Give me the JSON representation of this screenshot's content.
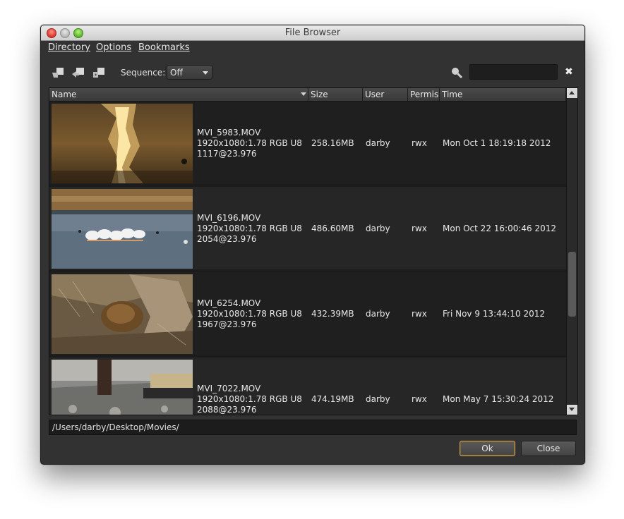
{
  "window": {
    "title": "File Browser"
  },
  "menu": [
    "Directory",
    "Options",
    "Bookmarks"
  ],
  "toolbar": {
    "icons": [
      "folder-back-icon",
      "folder-up-icon",
      "folder-new-icon"
    ],
    "sequence_label": "Sequence:",
    "sequence_value": "Off",
    "search_value": ""
  },
  "columns": [
    "Name",
    "Size",
    "User",
    "Permis",
    "Time"
  ],
  "files": [
    {
      "name": "MVI_5983.MOV",
      "spec": "1920x1080:1.78 RGB U8",
      "frames": "1117@23.976",
      "size": "258.16MB",
      "user": "darby",
      "perm": "rwx",
      "time": "Mon Oct  1 18:19:18 2012"
    },
    {
      "name": "MVI_6196.MOV",
      "spec": "1920x1080:1.78 RGB U8",
      "frames": "2054@23.976",
      "size": "486.60MB",
      "user": "darby",
      "perm": "rwx",
      "time": "Mon Oct 22 16:00:46 2012"
    },
    {
      "name": "MVI_6254.MOV",
      "spec": "1920x1080:1.78 RGB U8",
      "frames": "1967@23.976",
      "size": "432.39MB",
      "user": "darby",
      "perm": "rwx",
      "time": "Fri Nov  9 13:44:10 2012"
    },
    {
      "name": "MVI_7022.MOV",
      "spec": "1920x1080:1.78 RGB U8",
      "frames": "2088@23.976",
      "size": "474.19MB",
      "user": "darby",
      "perm": "rwx",
      "time": "Mon May  7 15:30:24 2012"
    }
  ],
  "path": "/Users/darby/Desktop/Movies/",
  "buttons": {
    "ok": "Ok",
    "close": "Close"
  },
  "colors": {
    "accent": "#c8a35a",
    "window_bg": "#323232"
  }
}
